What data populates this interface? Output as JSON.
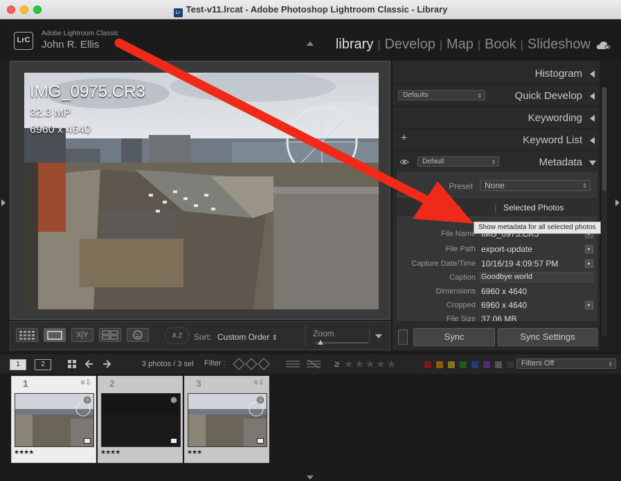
{
  "window": {
    "title": "Test-v11.lrcat - Adobe Photoshop Lightroom Classic - Library",
    "icon": "lrc-catalog-icon"
  },
  "identity": {
    "logo": "LrC",
    "app_name": "Adobe Lightroom Classic",
    "user": "John R. Ellis"
  },
  "modules": [
    {
      "label": "library",
      "active": true
    },
    {
      "label": "Develop",
      "active": false
    },
    {
      "label": "Map",
      "active": false
    },
    {
      "label": "Book",
      "active": false
    },
    {
      "label": "Slideshow",
      "active": false
    }
  ],
  "loupe": {
    "file_name": "IMG_0975.CR3",
    "megapixels": "32.3 MP",
    "dimensions": "6960 x 4640"
  },
  "toolbar": {
    "sort_label": "Sort:",
    "sort_value": "Custom Order",
    "sort_arrows": "⇕",
    "zoom_label": "Zoom",
    "zoom_value": 0.1,
    "compare_label": "X|Y",
    "az_label": "A Z"
  },
  "panels": {
    "histogram": "Histogram",
    "quick_develop": "Quick Develop",
    "quick_develop_preset": "Defaults",
    "keywording": "Keywording",
    "keyword_list": "Keyword List",
    "keyword_list_add": "+",
    "metadata": "Metadata",
    "metadata_preset": "Default"
  },
  "metadata": {
    "preset_label": "Preset",
    "preset_value": "None",
    "target_photo_label": "t Photo",
    "selected_photos_label": "Selected Photos",
    "rows": [
      {
        "label": "File Name",
        "value": "IMG_0975.CR3",
        "button": true
      },
      {
        "label": "File Path",
        "value": "export-update",
        "button": true
      },
      {
        "label": "Capture Date/Time",
        "value": "10/16/19 4:09:57 PM",
        "button": true
      },
      {
        "label": "Caption",
        "value": "Goodbye world",
        "button": false
      },
      {
        "label": "Dimensions",
        "value": "6960 x 4640",
        "button": false
      },
      {
        "label": "Cropped",
        "value": "6960 x 4640",
        "button": true
      },
      {
        "label": "File Size",
        "value": "37.06 MB",
        "button": false
      }
    ]
  },
  "sync": {
    "sync_label": "Sync",
    "sync_settings_label": "Sync Settings"
  },
  "tooltip": "Show metadata for all selected photos",
  "filmbar": {
    "monitor1": "1",
    "monitor2": "2",
    "photo_count": "3 photos / 3 sel",
    "filter_label": "Filter :",
    "rating_op": "≥",
    "stars": "★★★★★",
    "filters_value": "Filters Off",
    "label_colors": [
      "#7a1c1c",
      "#8a5a14",
      "#7a7a1a",
      "#1f5a1f",
      "#1c3f7a",
      "#4d2a7a",
      "#555555",
      "#333333"
    ]
  },
  "filmstrip": [
    {
      "number": "1",
      "badge": "≡⇩",
      "stars": "★★★★",
      "selected": true,
      "dark": false
    },
    {
      "number": "2",
      "badge": "",
      "stars": "★★★★",
      "selected": true,
      "dark": true
    },
    {
      "number": "3",
      "badge": "≡⇩",
      "stars": "★★★",
      "selected": true,
      "dark": false
    }
  ],
  "colors": {
    "annotation_red": "#f02a18",
    "bg": "#1e1e1e",
    "panel": "#2a2a2a"
  }
}
